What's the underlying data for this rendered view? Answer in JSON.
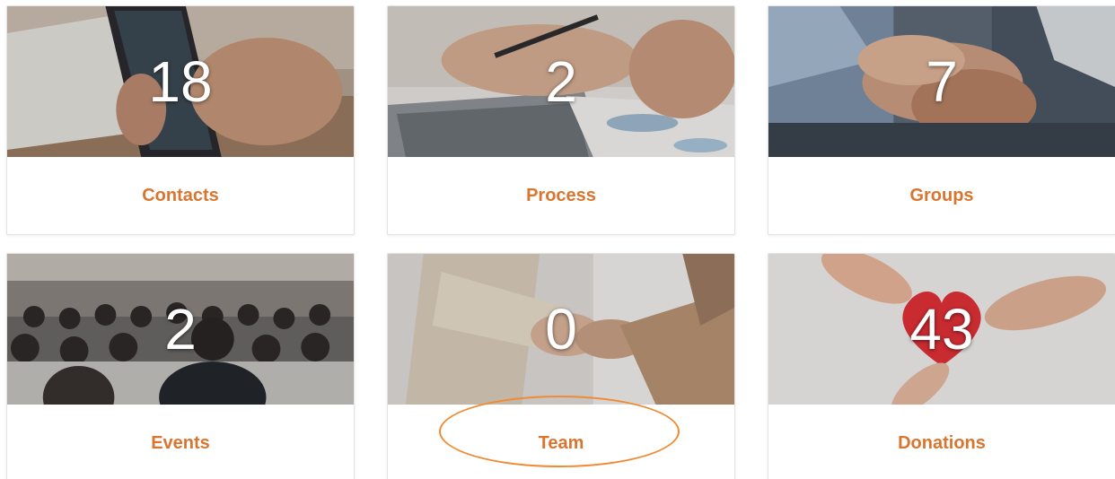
{
  "cards": [
    {
      "label": "Contacts",
      "count": "18",
      "icon": "contacts-image"
    },
    {
      "label": "Process",
      "count": "2",
      "icon": "process-image"
    },
    {
      "label": "Groups",
      "count": "7",
      "icon": "groups-image"
    },
    {
      "label": "Events",
      "count": "2",
      "icon": "events-image"
    },
    {
      "label": "Team",
      "count": "0",
      "icon": "team-image"
    },
    {
      "label": "Donations",
      "count": "43",
      "icon": "donations-image"
    }
  ],
  "colors": {
    "label": "#d9752e",
    "highlight": "#f08a33",
    "count_text": "#ffffff"
  }
}
